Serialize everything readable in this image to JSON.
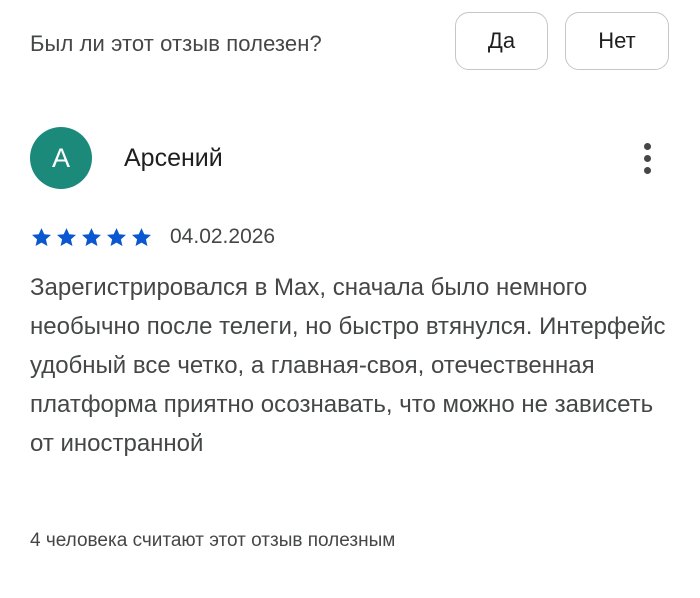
{
  "helpful_prompt": {
    "question": "Был ли этот отзыв полезен?",
    "yes_label": "Да",
    "no_label": "Нет"
  },
  "review": {
    "avatar_letter": "А",
    "avatar_color": "#1b8a7a",
    "author": "Арсений",
    "more_icon": "more-vert-icon",
    "rating": 5,
    "rating_max": 5,
    "star_color": "#0b57d0",
    "date": "04.02.2026",
    "text": "Зарегистрировался в Max, сначала было немного необычно после телеги, но быстро втянулся. Интерфейс удобный все четко, а главная-своя, отечественная платформа приятно осознавать, что можно не зависеть от иностранной",
    "helpful_count_text": "4 человека считают этот отзыв полезным"
  }
}
